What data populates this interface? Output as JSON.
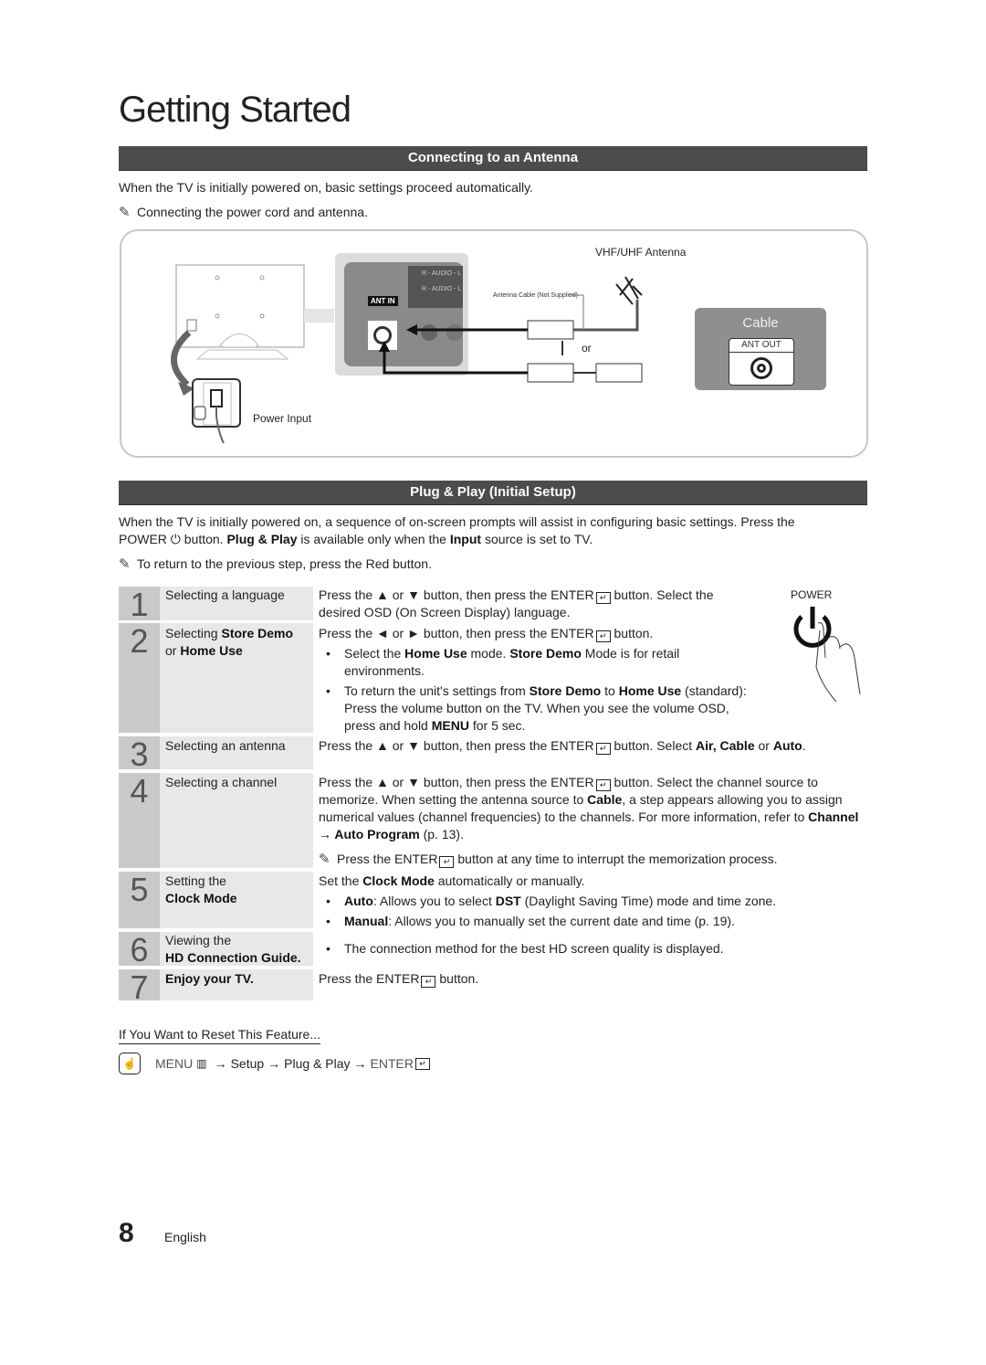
{
  "page_title": "Getting Started",
  "section1": {
    "title": "Connecting to an Antenna",
    "intro": "When the TV is initially powered on, basic settings proceed automatically.",
    "note": "Connecting the power cord and antenna.",
    "note_icon": "pencil-note-icon",
    "diagram": {
      "vhf_label": "VHF/UHF Antenna",
      "cable_note": "Antenna Cable (Not Supplied)",
      "or_label": "or",
      "ant_in_label": "ANT IN",
      "audio_label_1": "R - AUDIO - L",
      "audio_label_2": "R - AUDIO - L",
      "cable_box_title": "Cable",
      "ant_out_label": "ANT OUT",
      "power_input_label": "Power Input"
    }
  },
  "section2": {
    "title": "Plug & Play (Initial Setup)",
    "intro_part1": "When the TV is initially powered on, a sequence of on-screen prompts will assist in configuring basic settings. Press the",
    "power_word": "POWER",
    "intro_part2": "button.",
    "plug_play": "Plug & Play",
    "intro_part3": "is available only when the",
    "input_word": "Input",
    "intro_part4": "source is set to TV.",
    "note": "To return to the previous step, press the Red button.",
    "power_graphic_label": "POWER",
    "steps": [
      {
        "num": "1",
        "label": "Selecting a language",
        "desc1": "Press the ▲ or ▼ button, then press the ENTER",
        "desc2": "button. Select the desired OSD (On Screen Display) language."
      },
      {
        "num": "2",
        "label_a": "Selecting ",
        "label_b": "Store Demo",
        "label_c": "or ",
        "label_d": "Home Use",
        "desc1": "Press the ◄ or ► button, then press the ENTER",
        "desc2": "button.",
        "bullets": [
          {
            "a": "Select the ",
            "b": "Home Use",
            "c": " mode. ",
            "d": "Store Demo",
            "e": " Mode is for retail environments."
          },
          {
            "a": "To return the unit's settings from ",
            "b": "Store Demo",
            "c": " to ",
            "d": "Home Use",
            "e": " (standard): Press the volume button on the TV. When you see the volume OSD, press and hold ",
            "f": "MENU",
            "g": " for 5 sec."
          }
        ]
      },
      {
        "num": "3",
        "label": "Selecting an antenna",
        "desc1": "Press the ▲ or ▼ button, then press the ENTER",
        "desc2": "button. Select ",
        "opt1": "Air, Cable",
        "or": " or ",
        "opt2": "Auto",
        "end": "."
      },
      {
        "num": "4",
        "label": "Selecting a channel",
        "desc1": "Press the ▲ or ▼ button, then press the ENTER",
        "desc2": "button. Select the channel source to memorize. When setting the antenna source to ",
        "cable": "Cable",
        "desc3": ", a step appears allowing you to assign numerical values (channel frequencies) to the channels. For more information, refer to ",
        "menu_path": "Channel → Auto Program",
        "page_ref": " (p. 13).",
        "note1": "Press the ENTER",
        "note2": "button at any time to interrupt the memorization process."
      },
      {
        "num": "5",
        "label_a": "Setting the",
        "label_b": "Clock Mode",
        "desc_a": "Set the ",
        "desc_b": "Clock Mode",
        "desc_c": " automatically or manually.",
        "bullets": [
          {
            "a": "Auto",
            "b": ": Allows you to select ",
            "c": "DST",
            "d": " (Daylight Saving Time) mode and time zone."
          },
          {
            "a": "Manual",
            "b": ": Allows you to manually set the current date and time (p. 19)."
          }
        ]
      },
      {
        "num": "6",
        "label_a": "Viewing the",
        "label_b": "HD Connection Guide.",
        "bullet": "The connection method for the best HD screen quality is displayed."
      },
      {
        "num": "7",
        "label": "Enjoy your TV.",
        "desc1": "Press the ENTER",
        "desc2": "button."
      }
    ]
  },
  "reset": {
    "title": "If You Want to Reset This Feature...",
    "menu": "MENU",
    "arrow": "→",
    "setup": "Setup",
    "plug_play": "Plug & Play",
    "enter": "ENTER"
  },
  "footer": {
    "page_number": "8",
    "language": "English"
  }
}
